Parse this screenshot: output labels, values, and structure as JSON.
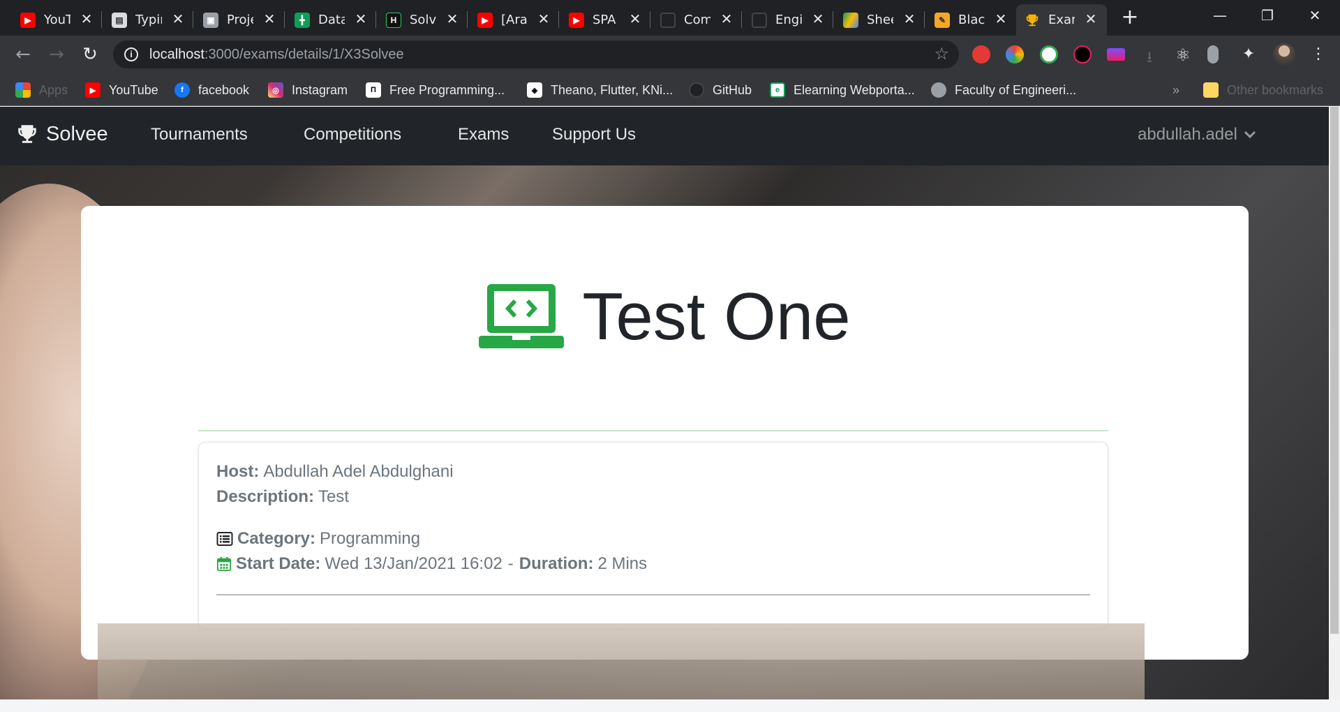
{
  "browser": {
    "tabs": [
      {
        "title": "YouTube",
        "icon": "youtube-icon",
        "color": "#ff0000"
      },
      {
        "title": "Typing",
        "icon": "document-icon",
        "color": "#dadce0"
      },
      {
        "title": "Project",
        "icon": "contact-icon",
        "color": "#9aa0a6"
      },
      {
        "title": "Data",
        "icon": "sheets-icon",
        "color": "#0f9d58"
      },
      {
        "title": "Solve",
        "icon": "hackerrank-icon",
        "color": "#111111"
      },
      {
        "title": "[Arabic",
        "icon": "youtube-icon",
        "color": "#ff0000"
      },
      {
        "title": "SPA",
        "icon": "youtube-icon",
        "color": "#ff0000"
      },
      {
        "title": "Com",
        "icon": "github-icon",
        "color": "#202124"
      },
      {
        "title": "Engi",
        "icon": "github-icon",
        "color": "#202124"
      },
      {
        "title": "Shee",
        "icon": "drive-icon",
        "color": "#fbbc04"
      },
      {
        "title": "Black",
        "icon": "pencil-icon",
        "color": "#f6a623"
      },
      {
        "title": "Exam",
        "icon": "trophy-icon",
        "color": "#f4b400",
        "active": true
      }
    ],
    "new_tab_symbol": "+",
    "url_host": "localhost",
    "url_path": ":3000/exams/details/1/X3Solvee",
    "bookmarks": [
      {
        "label": "Apps",
        "icon": "apps-grid-icon",
        "dim": true
      },
      {
        "label": "YouTube",
        "icon": "youtube-icon"
      },
      {
        "label": "facebook",
        "icon": "facebook-icon"
      },
      {
        "label": "Instagram",
        "icon": "instagram-icon"
      },
      {
        "label": "Free Programming...",
        "icon": "book-icon"
      },
      {
        "label": "Theano, Flutter, KNi...",
        "icon": "diamond-icon"
      },
      {
        "label": "GitHub",
        "icon": "github-icon"
      },
      {
        "label": "Elearning Webporta...",
        "icon": "elearning-icon"
      },
      {
        "label": "Faculty of Engineeri...",
        "icon": "globe-icon"
      }
    ],
    "bookmarks_overflow": "»",
    "other_bookmarks": "Other bookmarks"
  },
  "app": {
    "brand": "Solvee",
    "nav": [
      "Tournaments",
      "Competitions",
      "Exams",
      "Support Us"
    ],
    "user": "abdullah.adel",
    "accent_color": "#28a745"
  },
  "exam": {
    "title": "Test One",
    "host_label": "Host:",
    "host": "Abdullah Adel Abdulghani",
    "description_label": "Description:",
    "description": "Test",
    "category_label": "Category:",
    "category": "Programming",
    "start_label": "Start Date:",
    "start": "Wed 13/Jan/2021 16:02",
    "separator": "-",
    "duration_label": "Duration:",
    "duration": "2 Mins"
  }
}
